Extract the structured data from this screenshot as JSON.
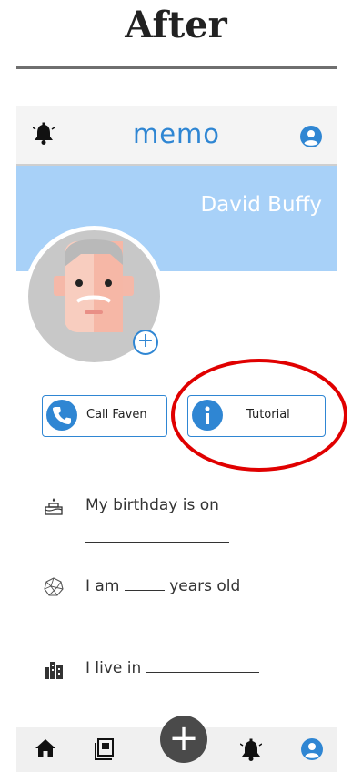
{
  "caption": {
    "title": "After"
  },
  "header": {
    "title": "memo",
    "bell_icon": "bell-icon",
    "profile_icon": "user-circle-icon"
  },
  "profile": {
    "name": "David Buffy",
    "add_symbol": "+"
  },
  "actions": [
    {
      "label": "Call Faven",
      "icon": "phone-icon"
    },
    {
      "label": "Tutorial",
      "icon": "info-icon"
    }
  ],
  "info": {
    "birthday": {
      "text": "My birthday is on"
    },
    "age": {
      "prefix": "I am",
      "suffix": "years old"
    },
    "residence": {
      "prefix": "I live in"
    }
  },
  "nav": {
    "items": [
      "home-icon",
      "photo-book-icon",
      "add-icon",
      "bell-icon",
      "user-circle-icon"
    ],
    "fab_symbol": "+"
  },
  "colors": {
    "accent": "#2f86d3",
    "banner": "#a8d1f8",
    "highlight": "#e00000"
  }
}
